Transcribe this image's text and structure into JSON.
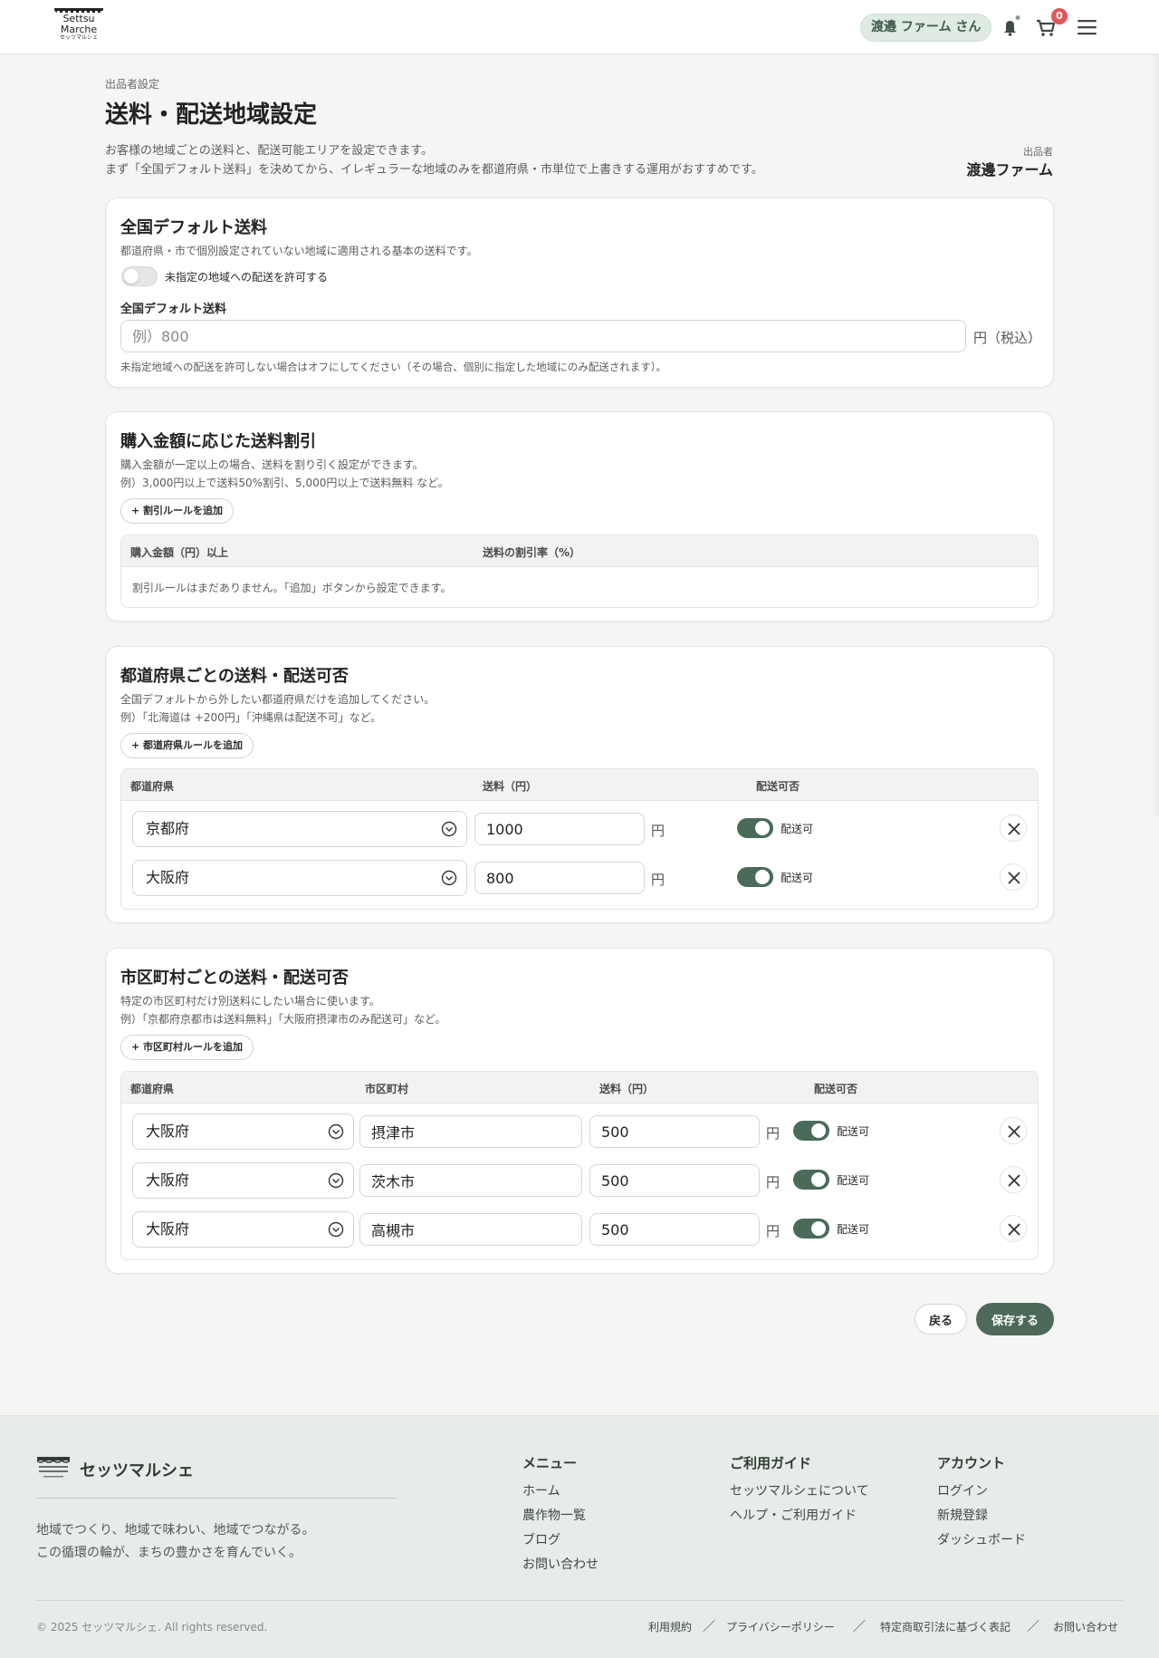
{
  "header": {
    "logo_text_1": "Settsu",
    "logo_text_2": "Marche",
    "logo_sub": "セッツマルシェ",
    "user_label": "渡邉 ファーム さん",
    "cart_count": "0",
    "icons": [
      "bell-icon",
      "cart-icon",
      "menu-icon"
    ]
  },
  "page": {
    "breadcrumb": "出品者設定",
    "title": "送料・配送地域設定",
    "desc_1": "お客様の地域ごとの送料と、配送可能エリアを設定できます。",
    "desc_2": "まず「全国デフォルト送料」を決めてから、イレギュラーな地域のみを都道府県・市単位で上書きする運用がおすすめです。",
    "seller_label": "出品者",
    "seller_name": "渡邊ファーム"
  },
  "default_section": {
    "title": "全国デフォルト送料",
    "text": "都道府県・市で個別設定されていない地域に適用される基本の送料です。",
    "toggle_label": "未指定の地域への配送を許可する",
    "toggle_on": false,
    "field_label": "全国デフォルト送料",
    "placeholder": "例）800",
    "value": "",
    "unit": "円（税込）",
    "note": "未指定地域への配送を許可しない場合はオフにしてください（その場合、個別に指定した地域にのみ配送されます）。"
  },
  "discount_section": {
    "title": "購入金額に応じた送料割引",
    "text_1": "購入金額が一定以上の場合、送料を割り引く設定ができます。",
    "text_2": "例）3,000円以上で送料50%割引、5,000円以上で送料無料 など。",
    "add_label": "+ 割引ルールを追加",
    "col_amount": "購入金額（円）以上",
    "col_rate": "送料の割引率（%）",
    "empty": "割引ルールはまだありません。「追加」ボタンから設定できます。"
  },
  "pref_section": {
    "title": "都道府県ごとの送料・配送可否",
    "text_1": "全国デフォルトから外したい都道府県だけを追加してください。",
    "text_2": "例）「北海道は +200円」「沖縄県は配送不可」など。",
    "add_label": "+ 都道府県ルールを追加",
    "col_pref": "都道府県",
    "col_fee": "送料（円）",
    "col_ship": "配送可否",
    "rows": [
      {
        "pref": "京都府",
        "fee": "1000",
        "unit": "円",
        "ship_label": "配送可",
        "ship_on": true
      },
      {
        "pref": "大阪府",
        "fee": "800",
        "unit": "円",
        "ship_label": "配送可",
        "ship_on": true
      }
    ]
  },
  "city_section": {
    "title": "市区町村ごとの送料・配送可否",
    "text_1": "特定の市区町村だけ別送料にしたい場合に使います。",
    "text_2": "例）「京都府京都市は送料無料」「大阪府摂津市のみ配送可」など。",
    "add_label": "+ 市区町村ルールを追加",
    "col_pref": "都道府県",
    "col_city": "市区町村",
    "col_fee": "送料（円）",
    "col_ship": "配送可否",
    "rows": [
      {
        "pref": "大阪府",
        "city": "摂津市",
        "fee": "500",
        "unit": "円",
        "ship_label": "配送可",
        "ship_on": true
      },
      {
        "pref": "大阪府",
        "city": "茨木市",
        "fee": "500",
        "unit": "円",
        "ship_label": "配送可",
        "ship_on": true
      },
      {
        "pref": "大阪府",
        "city": "高槻市",
        "fee": "500",
        "unit": "円",
        "ship_label": "配送可",
        "ship_on": true
      }
    ]
  },
  "actions": {
    "back": "戻る",
    "save": "保存する"
  },
  "footer": {
    "brand": "セッツマルシェ",
    "tagline_1": "地域でつくり、地域で味わい、地域でつながる。",
    "tagline_2": "この循環の輪が、まちの豊かさを育んでいく。",
    "menu_title": "メニュー",
    "menu": [
      "ホーム",
      "農作物一覧",
      "ブログ",
      "お問い合わせ"
    ],
    "guide_title": "ご利用ガイド",
    "guide": [
      "セッツマルシェについて",
      "ヘルプ・ご利用ガイド"
    ],
    "account_title": "アカウント",
    "account": [
      "ログイン",
      "新規登録",
      "ダッシュボード"
    ],
    "copyright": "© 2025 セッツマルシェ. All rights reserved.",
    "legal": [
      "利用規約",
      "プライバシーポリシー",
      "特定商取引法に基づく表記",
      "お問い合わせ"
    ],
    "separator": "／"
  },
  "colors": {
    "accent": "#4d6a58",
    "accent_light": "#dfeae3",
    "badge": "#e35656"
  }
}
